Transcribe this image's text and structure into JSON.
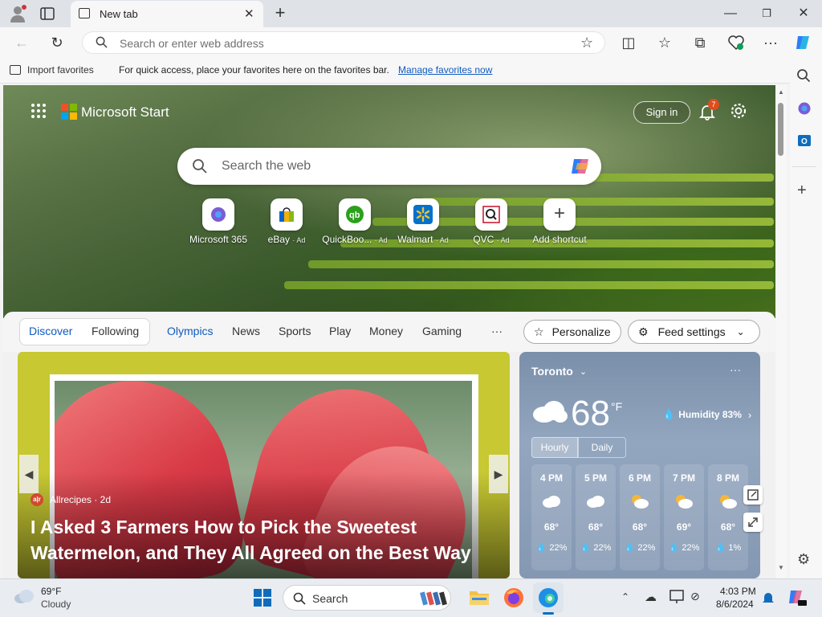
{
  "browser": {
    "tab_title": "New tab",
    "address_placeholder": "Search or enter web address",
    "favbar": {
      "import_label": "Import favorites",
      "message": "For quick access, place your favorites here on the favorites bar.",
      "manage_link": "Manage favorites now"
    }
  },
  "start": {
    "brand": "Microsoft Start",
    "sign_in": "Sign in",
    "notification_count": "7",
    "search_placeholder": "Search the web",
    "shortcuts": [
      {
        "label": "Microsoft 365",
        "ad": ""
      },
      {
        "label": "eBay",
        "ad": "· Ad"
      },
      {
        "label": "QuickBoo...",
        "ad": "· Ad"
      },
      {
        "label": "Walmart",
        "ad": "· Ad"
      },
      {
        "label": "QVC",
        "ad": "· Ad"
      },
      {
        "label": "Add shortcut",
        "ad": ""
      }
    ]
  },
  "feed": {
    "tabs": {
      "discover": "Discover",
      "following": "Following",
      "olympics": "Olympics",
      "news": "News",
      "sports": "Sports",
      "play": "Play",
      "money": "Money",
      "gaming": "Gaming",
      "more": "···"
    },
    "personalize": "Personalize",
    "feed_settings": "Feed settings"
  },
  "article": {
    "source_logo": "a|r",
    "source": "Allrecipes · 2d",
    "headline": "I Asked 3 Farmers How to Pick the Sweetest Watermelon, and They All Agreed on the Best Way"
  },
  "weather": {
    "city": "Toronto",
    "more": "···",
    "temp": "68",
    "unit": "°F",
    "humidity": "Humidity 83%",
    "tab_hourly": "Hourly",
    "tab_daily": "Daily",
    "hours": [
      {
        "time": "4 PM",
        "temp": "68°",
        "precip": "💧 22%",
        "icon": "cloudy-icon"
      },
      {
        "time": "5 PM",
        "temp": "68°",
        "precip": "💧 22%",
        "icon": "cloudy-icon"
      },
      {
        "time": "6 PM",
        "temp": "68°",
        "precip": "💧 22%",
        "icon": "partly-sunny-icon"
      },
      {
        "time": "7 PM",
        "temp": "69°",
        "precip": "💧 22%",
        "icon": "partly-sunny-icon"
      },
      {
        "time": "8 PM",
        "temp": "68°",
        "precip": "💧 1%",
        "icon": "partly-sunny-icon"
      }
    ]
  },
  "taskbar": {
    "weather_temp": "69°F",
    "weather_desc": "Cloudy",
    "search_label": "Search",
    "time": "4:03 PM",
    "date": "8/6/2024"
  }
}
